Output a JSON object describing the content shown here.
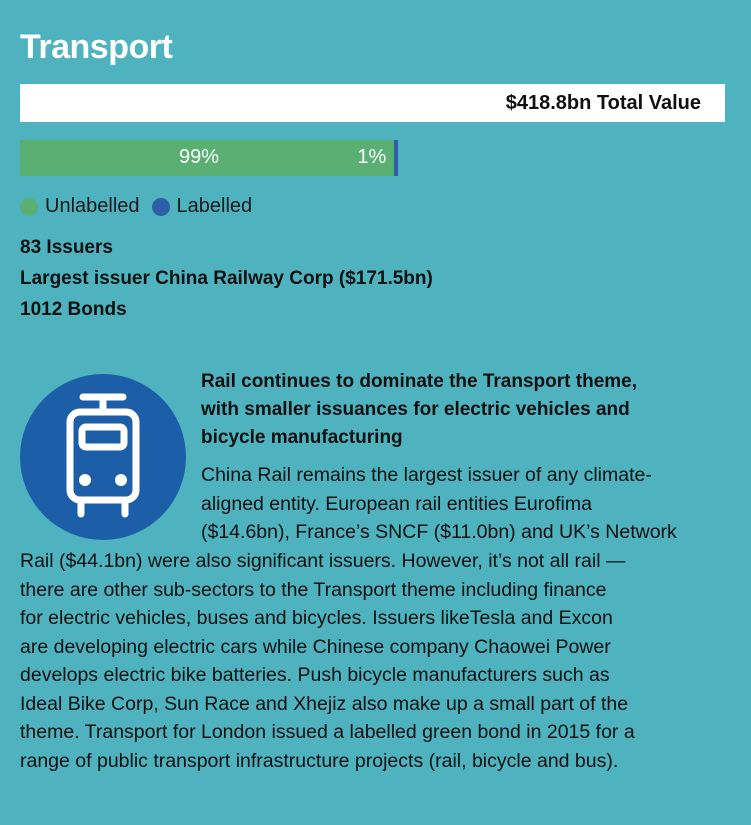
{
  "title": "Transport",
  "total": "$418.8bn Total Value",
  "chart_data": {
    "type": "bar",
    "orientation": "horizontal-stacked",
    "series": [
      {
        "name": "Unlabelled",
        "values": [
          99
        ],
        "color": "#5aaf72"
      },
      {
        "name": "Labelled",
        "values": [
          1
        ],
        "color": "#2e5fa8"
      }
    ],
    "data_labels": [
      "99%",
      "1%"
    ]
  },
  "legend": {
    "unlabelled": "Unlabelled",
    "labelled": "Labelled"
  },
  "stats": {
    "issuers": "83 Issuers",
    "largest": "Largest issuer China Railway Corp ($171.5bn)",
    "bonds": "1012 Bonds"
  },
  "icon": "tram-icon",
  "lead": [
    "Rail continues to dominate the Transport theme,",
    "with smaller issuances for electric vehicles and",
    "bicycle manufacturing"
  ],
  "body_first": [
    "China Rail remains the largest issuer of any climate-",
    "aligned entity. European rail entities Eurofima",
    "($14.6bn), France’s SNCF ($11.0bn) and UK’s Network"
  ],
  "body_rest": [
    "Rail ($44.1bn) were also significant issuers.  However, it’s not all rail —",
    "there are other sub-sectors to the Transport theme including finance",
    "for electric vehicles, buses and bicycles. Issuers likeTesla and Excon",
    "are developing electric cars while Chinese company Chaowei Power",
    "develops electric bike batteries. Push bicycle manufacturers such as",
    "Ideal Bike Corp, Sun Race and Xhejiz also make up a small part of the",
    "theme.  Transport for London issued a labelled green bond in 2015 for a",
    "range of public transport infrastructure projects (rail, bicycle and bus)."
  ],
  "colors": {
    "background": "#4eb3bf",
    "unlabelled": "#5aaf72",
    "labelled": "#2e5fa8",
    "icon_circle": "#1c5fa8",
    "icon_fg": "#ffffff"
  }
}
